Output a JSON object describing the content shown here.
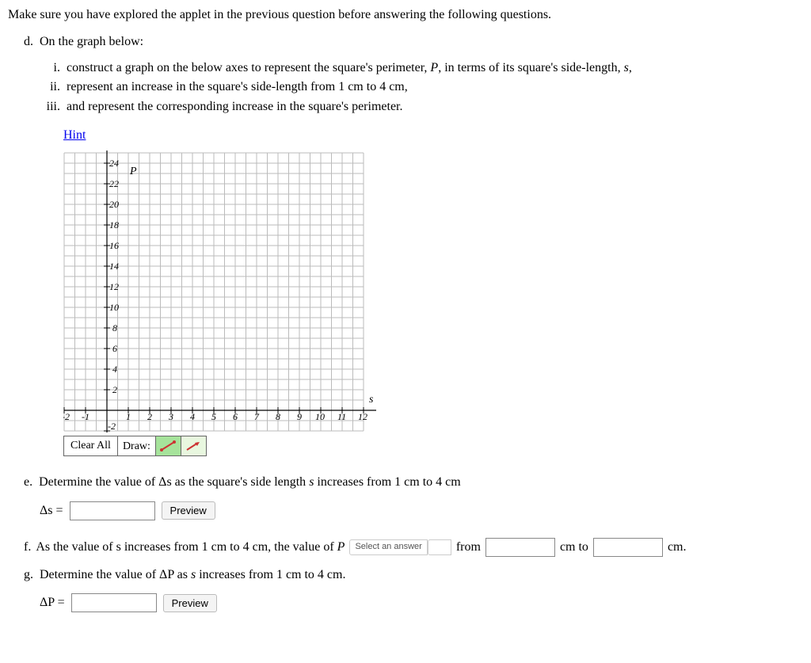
{
  "intro": "Make sure you have explored the applet in the previous question before answering the following questions.",
  "d": {
    "label": "d.",
    "text": "On the graph below:",
    "i_num": "i.",
    "i_text_a": "construct a graph on the below axes to represent the square's perimeter, ",
    "i_text_P": "P",
    "i_text_b": ", in terms of its square's side-length, ",
    "i_text_s": "s",
    "i_text_c": ",",
    "ii_num": "ii.",
    "ii_text": "represent an increase in the square's side-length from 1 cm to 4 cm,",
    "iii_num": "iii.",
    "iii_text": "and represent the corresponding increase in the square's perimeter."
  },
  "hint": "Hint",
  "toolbar": {
    "clear": "Clear All",
    "draw": "Draw:"
  },
  "e": {
    "label": "e.",
    "text_a": "Determine the value of ",
    "delta_s": "Δs",
    "text_b": " as the square's side length ",
    "s": "s",
    "text_c": " increases from 1 cm to 4 cm",
    "lhs": "Δs =",
    "preview": "Preview"
  },
  "f": {
    "label": "f.",
    "text_a": "As the value of s increases from 1 cm to 4 cm, the value of ",
    "P": "P",
    "select_placeholder": "Select an answer",
    "from": "from",
    "cm_to": "cm to",
    "cm_end": "cm."
  },
  "g": {
    "label": "g.",
    "text_a": "Determine the value of ",
    "delta_P": "ΔP",
    "text_b": " as ",
    "s": "s",
    "text_c": " increases from 1 cm to 4 cm.",
    "lhs": "ΔP =",
    "preview": "Preview"
  },
  "chart_data": {
    "type": "line",
    "title": "",
    "xlabel": "s",
    "ylabel": "P",
    "x_ticks": [
      -2,
      -1,
      1,
      2,
      3,
      4,
      5,
      6,
      7,
      8,
      9,
      10,
      11,
      12
    ],
    "y_ticks": [
      -2,
      2,
      4,
      6,
      8,
      10,
      12,
      14,
      16,
      18,
      20,
      22,
      24
    ],
    "xlim": [
      -2,
      12
    ],
    "ylim": [
      -2,
      24
    ],
    "series": []
  }
}
